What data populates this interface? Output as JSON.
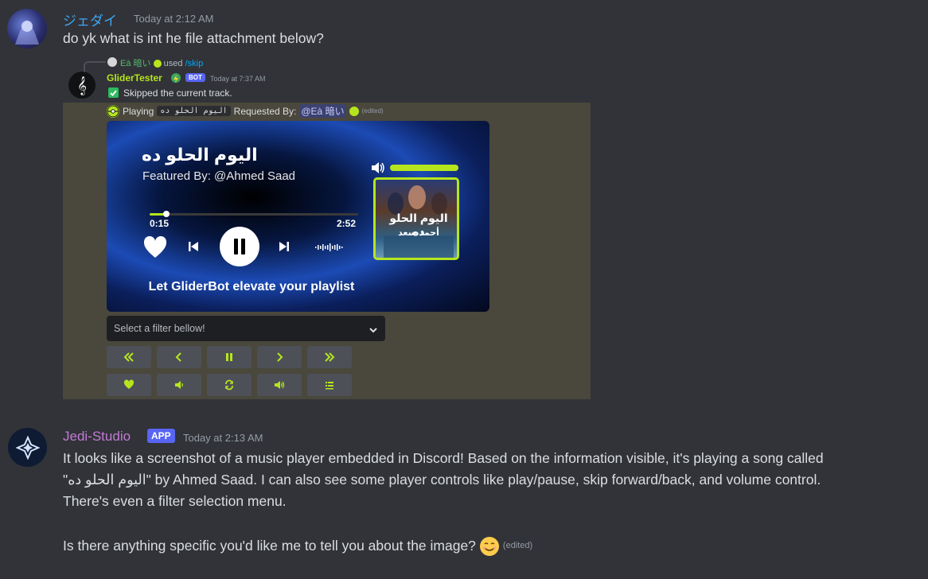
{
  "message1": {
    "username": "ジェダイ",
    "timestamp": "Today at 2:12 AM",
    "text": "do yk what is int he file attachment below?"
  },
  "embed": {
    "reply_user": "Eà 暗い",
    "reply_used": "used",
    "reply_command": "/skip",
    "bot_name": "GliderTester",
    "bot_tag": "BOT",
    "bot_timestamp": "Today at 7:37 AM",
    "skip_text": "Skipped the current track.",
    "playing_label": "Playing",
    "playing_song": "اليوم الحلو ده",
    "requested_by_label": "Requested By:",
    "requested_by_user": "@Eà 暗い",
    "edited_label": "(edited)",
    "player_card": {
      "song_title": "اليوم الحلو ده",
      "featured_by": "Featured By: @Ahmed Saad",
      "elapsed": "0:15",
      "duration": "2:52",
      "progress": 0.08,
      "volume_level": 1.0,
      "tagline": "Let GliderBot elevate your playlist",
      "album_title": "اليوم الحلو ده",
      "album_artist": "أحمد سعد"
    },
    "filter_select": {
      "placeholder": "Select a filter bellow!"
    },
    "buttons_row1": [
      "rewind-icon",
      "previous-icon",
      "pause-icon",
      "next-icon",
      "fast-forward-icon"
    ],
    "buttons_row2": [
      "heart-icon",
      "volume-down-icon",
      "loop-icon",
      "volume-up-icon",
      "queue-icon"
    ]
  },
  "message2": {
    "username": "Jedi-Studio",
    "app_tag": "APP",
    "timestamp": "Today at 2:13 AM",
    "paragraph1_line1": "It looks like a screenshot of a music player embedded in Discord! Based on the information visible, it's playing a song called",
    "paragraph1_line2": "\"اليوم الحلو ده\" by Ahmed Saad.  I can also see some player controls like play/pause, skip forward/back, and volume control.",
    "paragraph1_line3": "There's even a filter selection menu.",
    "paragraph2": "Is there anything specific you'd like me to tell you about the image?",
    "edited_label": "(edited)"
  },
  "colors": {
    "background": "#313338",
    "embed_bg": "#4a473c",
    "accent_green": "#b5e61d",
    "blurple": "#5865f2",
    "jedi_studio_name": "#c27ad6",
    "user1_name": "#3ea6f2"
  }
}
